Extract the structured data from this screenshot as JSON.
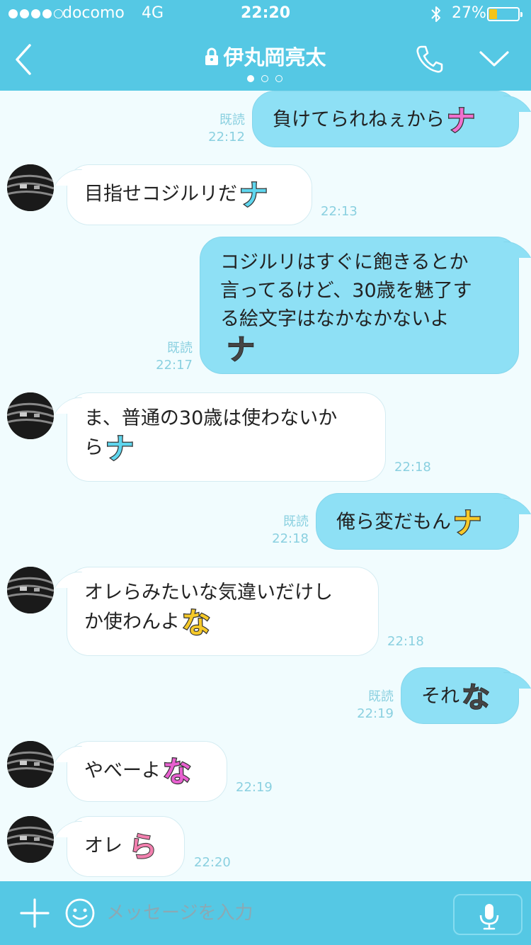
{
  "status": {
    "carrier": "docomo",
    "network": "4G",
    "time": "22:20",
    "battery": "27%",
    "battery_level": 0.27
  },
  "nav": {
    "title": "伊丸岡亮太",
    "pages": 3,
    "current_page": 1
  },
  "read_label": "既読",
  "messages": [
    {
      "dir": "out",
      "text": "負けてられねぇから",
      "time": "22:12",
      "read": true,
      "sticker": "ナ",
      "sticker_color": "#f070cf"
    },
    {
      "dir": "in",
      "text": "目指せコジルリだ",
      "time": "22:13",
      "sticker": "ナ",
      "sticker_color": "#5fd6ee"
    },
    {
      "dir": "out",
      "lines": [
        "コジルリはすぐに飽きるとか",
        "言ってるけど、30歳を魅了す",
        "る絵文字はなかなかないよ"
      ],
      "time": "22:17",
      "read": true,
      "sticker": "ナ",
      "sticker_color": "#454545"
    },
    {
      "dir": "in",
      "lines": [
        "ま、普通の30歳は使わないか",
        "ら"
      ],
      "time": "22:18",
      "sticker": "ナ",
      "sticker_color": "#5fd6ee"
    },
    {
      "dir": "out",
      "text": "俺ら変だもん",
      "time": "22:18",
      "read": true,
      "sticker": "ナ",
      "sticker_color": "#f6c928"
    },
    {
      "dir": "in",
      "lines": [
        "オレらみたいな気違いだけし",
        "か使わんよ"
      ],
      "time": "22:18",
      "sticker": "な",
      "sticker_color": "#f6c928"
    },
    {
      "dir": "out",
      "text": "それ",
      "time": "22:19",
      "read": true,
      "sticker": "な",
      "sticker_color": "#454545"
    },
    {
      "dir": "in",
      "text": "やべーよ",
      "time": "22:19",
      "sticker": "な",
      "sticker_color": "#e860d0"
    },
    {
      "dir": "in",
      "text": "オレ",
      "time": "22:20",
      "sticker": "ら",
      "sticker_color": "#f27fae"
    }
  ],
  "input": {
    "placeholder": "メッセージを入力"
  },
  "icons": {
    "back": "back-chevron-icon",
    "lock": "lock-icon",
    "call": "phone-icon",
    "menu": "chevron-down-icon",
    "add": "plus-icon",
    "emoji": "smiley-icon",
    "voice": "microphone-icon"
  },
  "colors": {
    "header": "#55c8e4",
    "chat_bg": "#f1fcfe",
    "out_bubble": "#8ee0f5",
    "in_bubble": "#ffffff",
    "meta_text": "#8ad0e0",
    "battery": "#f5c418"
  }
}
